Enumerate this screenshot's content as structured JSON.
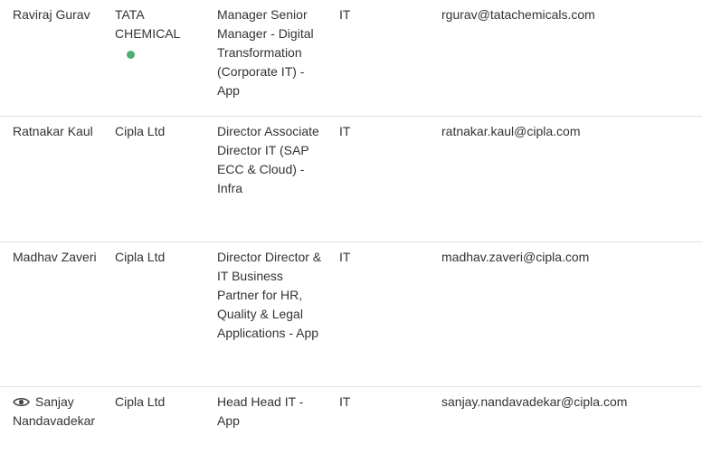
{
  "contacts": [
    {
      "name": "Raviraj Gurav",
      "company": "TATA CHEMICAL",
      "title": "Manager Senior Manager - Digital Transformation (Corporate IT) - App",
      "department": "IT",
      "email": "rgurav@tatachemicals.com",
      "status_color": "#4cae72"
    },
    {
      "name": "Ratnakar Kaul",
      "company": "Cipla Ltd",
      "title": "Director Associate Director IT (SAP ECC & Cloud) - Infra",
      "department": "IT",
      "email": "ratnakar.kaul@cipla.com"
    },
    {
      "name": "Madhav Zaveri",
      "company": "Cipla Ltd",
      "title": "Director Director & IT Business Partner for HR, Quality & Legal Applications - App",
      "department": "IT",
      "email": "madhav.zaveri@cipla.com"
    },
    {
      "name": "Sanjay Nandavadekar",
      "company": "Cipla Ltd",
      "title": "Head Head IT - App",
      "department": "IT",
      "email": "sanjay.nandavadekar@cipla.com",
      "icon": "eye-icon"
    }
  ]
}
